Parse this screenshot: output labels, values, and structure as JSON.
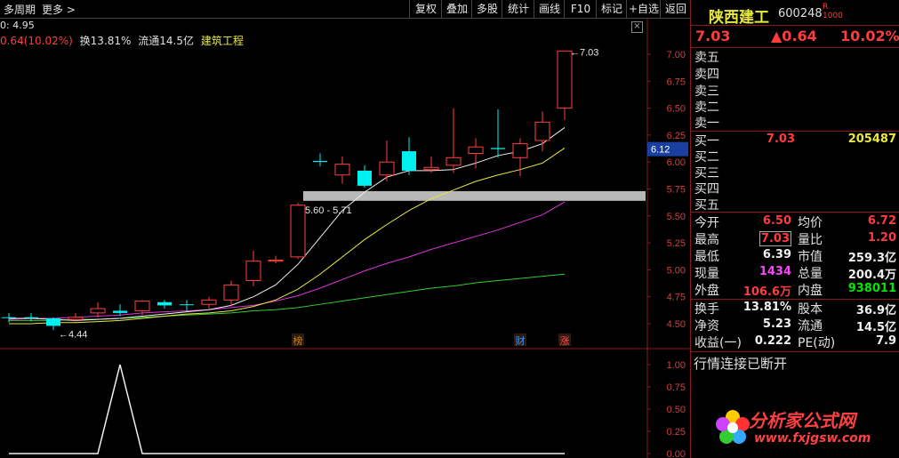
{
  "toolbar": {
    "period_label": "多周期",
    "more_label": "更多",
    "buttons": [
      "复权",
      "叠加",
      "多股",
      "统计",
      "画线",
      "F10",
      "标记",
      "+自选",
      "返回"
    ]
  },
  "info_line": {
    "line1": "0: 4.95",
    "change": "0.64(10.02%)",
    "turnover": "换13.81%",
    "float": "流通14.5亿",
    "sector": "建筑工程"
  },
  "chart_data": {
    "type": "candlestick",
    "ylim": [
      4.36,
      7.12
    ],
    "y_ticks": [
      "7.00",
      "6.75",
      "6.50",
      "6.25",
      "6.00",
      "5.75",
      "5.50",
      "5.25",
      "5.00",
      "4.75",
      "4.50"
    ],
    "candles": [
      {
        "o": 4.56,
        "h": 4.6,
        "l": 4.51,
        "c": 4.56
      },
      {
        "o": 4.56,
        "h": 4.6,
        "l": 4.52,
        "c": 4.56
      },
      {
        "o": 4.55,
        "h": 4.56,
        "l": 4.44,
        "c": 4.48
      },
      {
        "o": 4.54,
        "h": 4.6,
        "l": 4.52,
        "c": 4.56
      },
      {
        "o": 4.6,
        "h": 4.7,
        "l": 4.56,
        "c": 4.64
      },
      {
        "o": 4.6,
        "h": 4.68,
        "l": 4.57,
        "c": 4.62
      },
      {
        "o": 4.62,
        "h": 4.72,
        "l": 4.58,
        "c": 4.71
      },
      {
        "o": 4.7,
        "h": 4.72,
        "l": 4.64,
        "c": 4.67
      },
      {
        "o": 4.68,
        "h": 4.72,
        "l": 4.62,
        "c": 4.68
      },
      {
        "o": 4.68,
        "h": 4.75,
        "l": 4.64,
        "c": 4.72
      },
      {
        "o": 4.72,
        "h": 4.9,
        "l": 4.66,
        "c": 4.86
      },
      {
        "o": 4.9,
        "h": 5.18,
        "l": 4.85,
        "c": 5.08
      },
      {
        "o": 5.08,
        "h": 5.13,
        "l": 5.06,
        "c": 5.09
      },
      {
        "o": 5.12,
        "h": 5.62,
        "l": 5.1,
        "c": 5.6
      },
      {
        "o": 6.01,
        "h": 6.08,
        "l": 5.96,
        "c": 6.0
      },
      {
        "o": 5.88,
        "h": 6.05,
        "l": 5.8,
        "c": 5.98
      },
      {
        "o": 5.92,
        "h": 5.97,
        "l": 5.76,
        "c": 5.78
      },
      {
        "o": 5.88,
        "h": 6.2,
        "l": 5.82,
        "c": 6.0
      },
      {
        "o": 6.1,
        "h": 6.23,
        "l": 5.88,
        "c": 5.92
      },
      {
        "o": 5.93,
        "h": 6.05,
        "l": 5.9,
        "c": 5.95
      },
      {
        "o": 5.97,
        "h": 6.5,
        "l": 5.9,
        "c": 6.04
      },
      {
        "o": 6.08,
        "h": 6.22,
        "l": 5.94,
        "c": 6.14
      },
      {
        "o": 6.13,
        "h": 6.49,
        "l": 6.04,
        "c": 6.12
      },
      {
        "o": 6.04,
        "h": 6.22,
        "l": 5.87,
        "c": 6.17
      },
      {
        "o": 6.2,
        "h": 6.47,
        "l": 6.1,
        "c": 6.37
      },
      {
        "o": 6.5,
        "h": 7.03,
        "l": 6.39,
        "c": 7.03
      }
    ],
    "bearish_indices": [
      0,
      1,
      2,
      5,
      8,
      14,
      16,
      18,
      22
    ],
    "ma_white": [
      4.55,
      4.55,
      4.54,
      4.53,
      4.54,
      4.55,
      4.57,
      4.59,
      4.61,
      4.63,
      4.67,
      4.75,
      4.86,
      5.05,
      5.3,
      5.55,
      5.72,
      5.86,
      5.92,
      5.92,
      5.93,
      5.99,
      6.06,
      6.1,
      6.17,
      6.32
    ],
    "ma_yellow": [
      4.5,
      4.5,
      4.51,
      4.51,
      4.52,
      4.53,
      4.55,
      4.57,
      4.59,
      4.6,
      4.62,
      4.66,
      4.72,
      4.82,
      4.96,
      5.12,
      5.28,
      5.42,
      5.55,
      5.66,
      5.74,
      5.82,
      5.88,
      5.93,
      5.99,
      6.13
    ],
    "ma_magenta": [
      4.54,
      4.55,
      4.55,
      4.56,
      4.57,
      4.58,
      4.6,
      4.61,
      4.62,
      4.63,
      4.65,
      4.67,
      4.71,
      4.76,
      4.83,
      4.91,
      4.99,
      5.06,
      5.12,
      5.19,
      5.25,
      5.31,
      5.37,
      5.44,
      5.51,
      5.63
    ],
    "ma_green": [
      4.53,
      4.53,
      4.53,
      4.54,
      4.54,
      4.55,
      4.56,
      4.57,
      4.58,
      4.59,
      4.6,
      4.62,
      4.63,
      4.65,
      4.68,
      4.71,
      4.74,
      4.77,
      4.8,
      4.83,
      4.85,
      4.88,
      4.9,
      4.92,
      4.94,
      4.96
    ],
    "zone_band": [
      5.64,
      5.73
    ],
    "zone_label": "5.60 - 5.71",
    "high_marker": "7.03",
    "low_marker": "4.44",
    "price_tag": "6.12",
    "event_markers": [
      {
        "index": 13,
        "label": "榜",
        "color": "#d08000"
      },
      {
        "index": 23,
        "label": "财",
        "color": "#3399ff"
      },
      {
        "index": 25,
        "label": "涨",
        "color": "#ff5050"
      }
    ],
    "indicator": {
      "ylim": [
        0,
        1.1
      ],
      "y_ticks": [
        "1.00",
        "0.75",
        "0.50",
        "0.25",
        "0.00"
      ],
      "values": [
        0,
        0,
        0,
        0,
        0,
        1,
        0,
        0,
        0,
        0,
        0,
        0,
        0,
        0,
        0,
        0,
        0,
        0,
        0,
        0,
        0,
        0,
        0,
        0,
        0,
        0
      ]
    }
  },
  "stock": {
    "name": "陕西建工",
    "code": "600248",
    "badge_top": "R",
    "badge_bottom": "1000",
    "price": "7.03",
    "change": "▲0.64",
    "pct": "10.02%"
  },
  "orderbook": {
    "asks": [
      "卖五",
      "卖四",
      "卖三",
      "卖二",
      "卖一"
    ],
    "bids": [
      {
        "label": "买一",
        "price": "7.03",
        "vol": "205487"
      },
      {
        "label": "买二",
        "price": "",
        "vol": ""
      },
      {
        "label": "买三",
        "price": "",
        "vol": ""
      },
      {
        "label": "买四",
        "price": "",
        "vol": ""
      },
      {
        "label": "买五",
        "price": "",
        "vol": ""
      }
    ]
  },
  "stats": [
    {
      "l1": "今开",
      "v1": "6.50",
      "c1": "red",
      "l2": "均价",
      "v2": "6.72",
      "c2": "red"
    },
    {
      "l1": "最高",
      "v1": "7.03",
      "c1": "red",
      "l2": "量比",
      "v2": "1.20",
      "c2": "red"
    },
    {
      "l1": "最低",
      "v1": "6.39",
      "c1": "white",
      "l2": "市值",
      "v2": "259.3亿",
      "c2": "white"
    },
    {
      "l1": "现量",
      "v1": "1434",
      "c1": "magenta",
      "l2": "总量",
      "v2": "200.4万",
      "c2": "white"
    },
    {
      "l1": "外盘",
      "v1": "106.6万",
      "c1": "red",
      "l2": "内盘",
      "v2": "938011",
      "c2": "green"
    }
  ],
  "stats2": [
    {
      "l1": "换手",
      "v1": "13.81%",
      "c1": "white",
      "l2": "股本",
      "v2": "36.9亿",
      "c2": "white"
    },
    {
      "l1": "净资",
      "v1": "5.23",
      "c1": "white",
      "l2": "流通",
      "v2": "14.5亿",
      "c2": "white"
    },
    {
      "l1": "收益(一)",
      "v1": "0.222",
      "c1": "white",
      "l2": "PE(动)",
      "v2": "7.9",
      "c2": "white"
    }
  ],
  "status_text": "行情连接已断开",
  "watermark": {
    "brand": "分析家公式网",
    "url": "www.fxjgsw.com"
  }
}
